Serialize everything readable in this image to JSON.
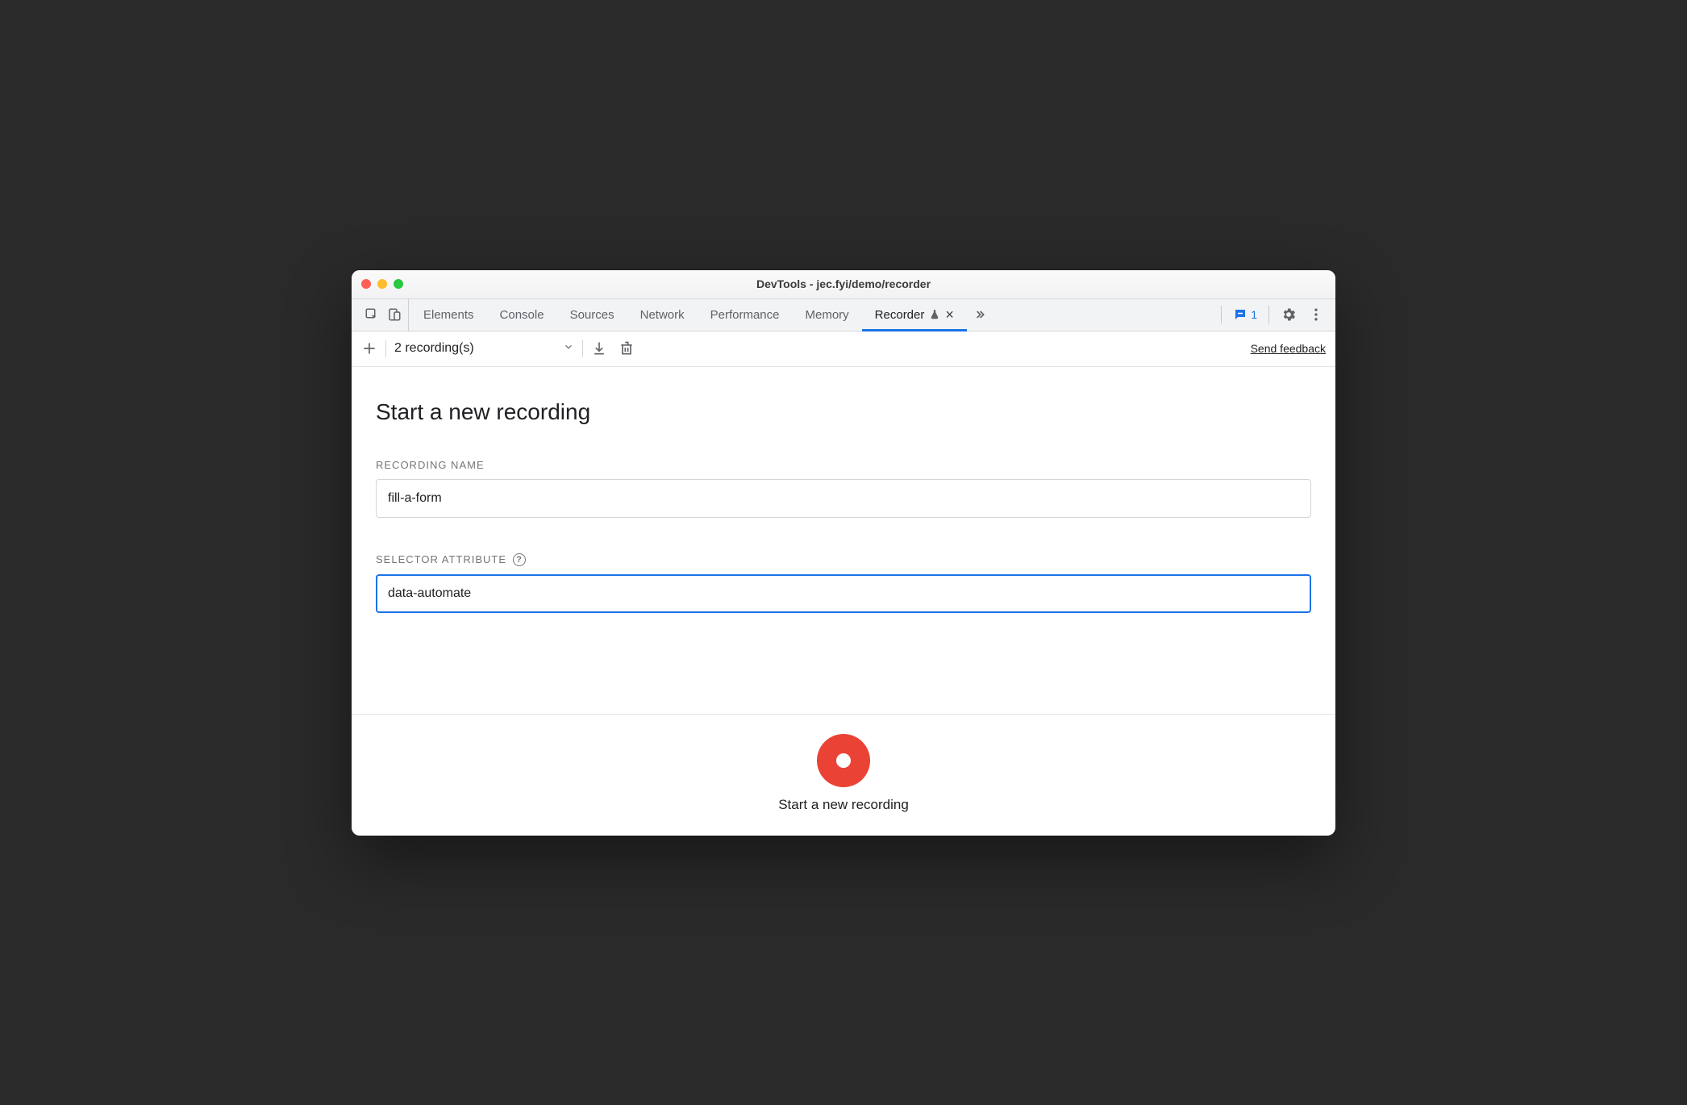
{
  "window": {
    "title": "DevTools - jec.fyi/demo/recorder"
  },
  "tabs": {
    "items": [
      {
        "label": "Elements"
      },
      {
        "label": "Console"
      },
      {
        "label": "Sources"
      },
      {
        "label": "Network"
      },
      {
        "label": "Performance"
      },
      {
        "label": "Memory"
      },
      {
        "label": "Recorder",
        "active": true,
        "experiment": true,
        "closable": true
      }
    ]
  },
  "issues": {
    "count": "1"
  },
  "toolbar": {
    "recordings_summary": "2 recording(s)",
    "feedback_label": "Send feedback"
  },
  "page": {
    "heading": "Start a new recording",
    "recording_name_label": "Recording Name",
    "recording_name_value": "fill-a-form",
    "selector_label": "Selector Attribute",
    "selector_value": "data-automate"
  },
  "footer": {
    "record_label": "Start a new recording"
  }
}
